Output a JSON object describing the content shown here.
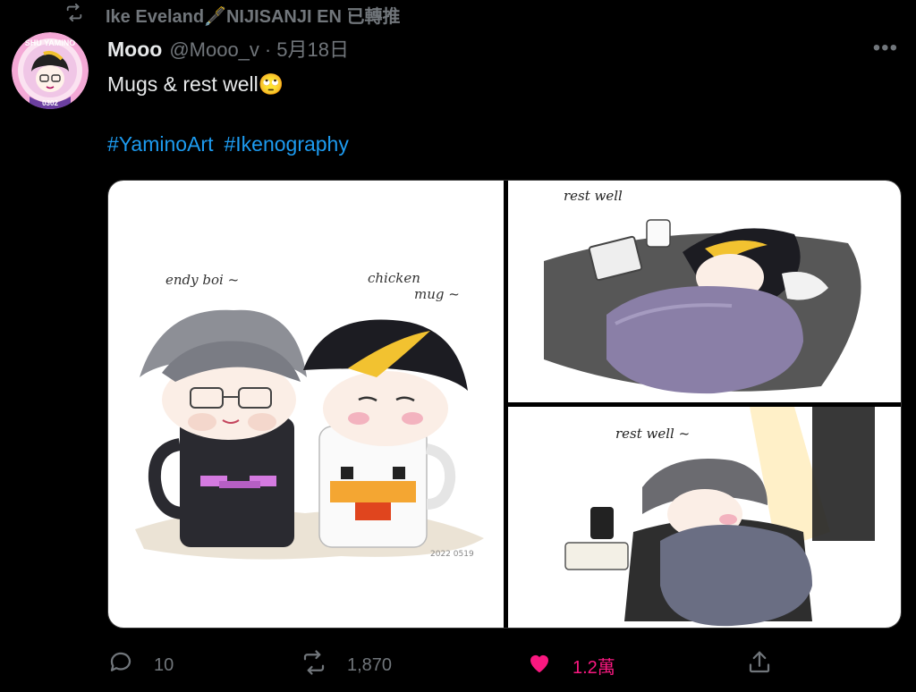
{
  "retweet": {
    "text": "Ike Eveland🖋️NIJISANJI EN 已轉推",
    "icon": "retweet-icon"
  },
  "author": {
    "name": "Mooo",
    "handle": "@Mooo_v",
    "separator": "·",
    "date": "5月18日"
  },
  "avatar": {
    "label_top": "SHU YAMINO",
    "label_bottom": "0302"
  },
  "tweet": {
    "text": "Mugs & rest well🙄",
    "hashtags": [
      "#YaminoArt",
      "#Ikenography"
    ]
  },
  "media": {
    "panel1": {
      "caption_left": "endy boi ~",
      "caption_right_1": "chicken",
      "caption_right_2": "mug ~",
      "signature": "2022 0519"
    },
    "panel2": {
      "caption": "rest well"
    },
    "panel3": {
      "caption": "rest well ~"
    }
  },
  "actions": {
    "reply": {
      "count": "10",
      "icon": "reply-icon"
    },
    "retweet": {
      "count": "1,870",
      "icon": "retweet-icon"
    },
    "like": {
      "count": "1.2萬",
      "icon": "heart-icon",
      "color": "#f91880"
    },
    "share": {
      "icon": "share-icon"
    }
  },
  "colors": {
    "background": "#000000",
    "text": "#e7e9ea",
    "muted": "#71767b",
    "link": "#1d9bf0",
    "like": "#f91880"
  }
}
